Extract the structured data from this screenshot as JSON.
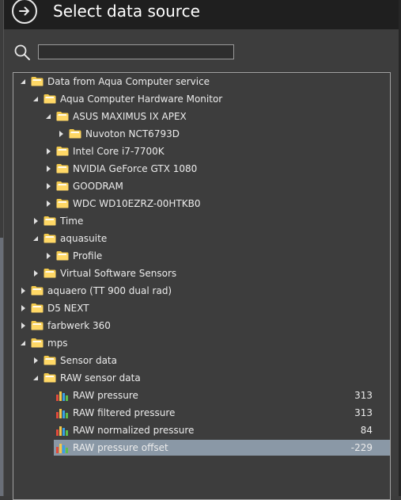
{
  "window": {
    "title": "Select data source"
  },
  "search": {
    "value": "",
    "placeholder": ""
  },
  "tree": [
    {
      "label": "Data from Aqua Computer service",
      "level": 0,
      "state": "expanded",
      "kind": "folder"
    },
    {
      "label": "Aqua Computer Hardware Monitor",
      "level": 1,
      "state": "expanded",
      "kind": "folder"
    },
    {
      "label": "ASUS MAXIMUS IX APEX",
      "level": 2,
      "state": "expanded",
      "kind": "folder"
    },
    {
      "label": "Nuvoton NCT6793D",
      "level": 3,
      "state": "collapsed",
      "kind": "folder"
    },
    {
      "label": "Intel Core i7-7700K",
      "level": 2,
      "state": "collapsed",
      "kind": "folder"
    },
    {
      "label": "NVIDIA GeForce GTX 1080",
      "level": 2,
      "state": "collapsed",
      "kind": "folder"
    },
    {
      "label": "GOODRAM",
      "level": 2,
      "state": "collapsed",
      "kind": "folder"
    },
    {
      "label": "WDC WD10EZRZ-00HTKB0",
      "level": 2,
      "state": "collapsed",
      "kind": "folder"
    },
    {
      "label": "Time",
      "level": 1,
      "state": "collapsed",
      "kind": "folder"
    },
    {
      "label": "aquasuite",
      "level": 1,
      "state": "expanded",
      "kind": "folder"
    },
    {
      "label": "Profile",
      "level": 2,
      "state": "collapsed",
      "kind": "folder"
    },
    {
      "label": "Virtual Software Sensors",
      "level": 1,
      "state": "collapsed",
      "kind": "folder"
    },
    {
      "label": "aquaero (TT 900 dual rad)",
      "level": 0,
      "state": "collapsed",
      "kind": "folder"
    },
    {
      "label": "D5 NEXT",
      "level": 0,
      "state": "collapsed",
      "kind": "folder"
    },
    {
      "label": "farbwerk 360",
      "level": 0,
      "state": "collapsed",
      "kind": "folder"
    },
    {
      "label": "mps",
      "level": 0,
      "state": "expanded",
      "kind": "folder"
    },
    {
      "label": "Sensor data",
      "level": 1,
      "state": "collapsed",
      "kind": "folder"
    },
    {
      "label": "RAW sensor data",
      "level": 1,
      "state": "expanded",
      "kind": "folder"
    },
    {
      "label": "RAW pressure",
      "level": 2,
      "kind": "sensor",
      "value": "313"
    },
    {
      "label": "RAW filtered pressure",
      "level": 2,
      "kind": "sensor",
      "value": "313"
    },
    {
      "label": "RAW normalized pressure",
      "level": 2,
      "kind": "sensor",
      "value": "84"
    },
    {
      "label": "RAW pressure offset",
      "level": 2,
      "kind": "sensor",
      "value": "-229",
      "selected": true
    }
  ],
  "colors": {
    "header_bg": "#1f1f1f",
    "panel_bg": "#3d3d3d",
    "folder_yellow": "#f2c94c",
    "selection": "#8a98a6"
  },
  "icons": {
    "back": "arrow-right-circle-icon",
    "search": "search-icon",
    "folder": "folder-icon",
    "sensor": "bar-chart-icon",
    "expanded": "caret-down-icon",
    "collapsed": "caret-right-icon"
  }
}
